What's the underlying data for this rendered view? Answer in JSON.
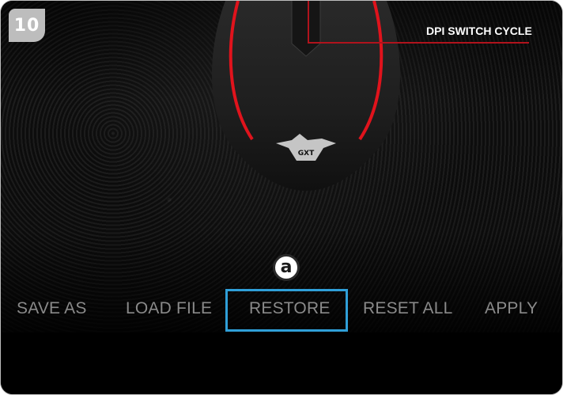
{
  "step": {
    "number": "10"
  },
  "callout": {
    "label": "DPI SWITCH CYCLE"
  },
  "annotation": {
    "letter": "a"
  },
  "menu": {
    "items": [
      {
        "label": "SAVE AS"
      },
      {
        "label": "LOAD FILE"
      },
      {
        "label": "RESTORE"
      },
      {
        "label": "RESET ALL"
      },
      {
        "label": "APPLY"
      }
    ],
    "highlighted": "RESTORE"
  },
  "colors": {
    "accent_blue": "#2f9fd8",
    "accent_red": "#b0131c",
    "menu_text": "#8a8a8a",
    "badge": "#bdbdbd"
  },
  "icons": {
    "mouse": "gaming-mouse-icon",
    "brand": "trust-gxt-logo-icon"
  }
}
